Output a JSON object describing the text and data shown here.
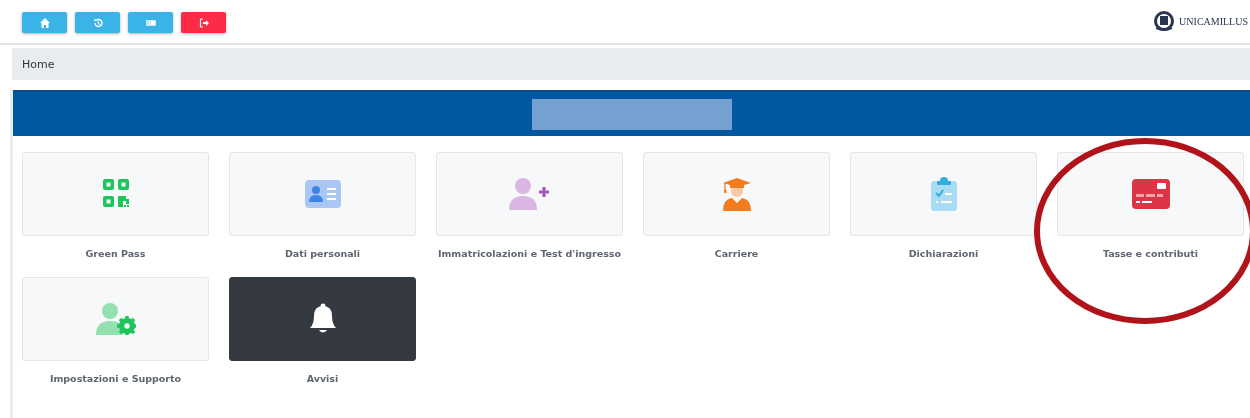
{
  "toolbar": {
    "buttons": [
      {
        "kind": "home",
        "color": "#3ab4e6"
      },
      {
        "kind": "history",
        "color": "#3ab4e6"
      },
      {
        "kind": "id-card",
        "color": "#3ab4e6"
      },
      {
        "kind": "logout",
        "color": "#fd2b46"
      }
    ]
  },
  "logo": {
    "text": "UNICAMILLUS"
  },
  "breadcrumb": {
    "text": "Home"
  },
  "banner": {
    "redacted": true
  },
  "tiles": [
    {
      "label": "Green Pass",
      "kind": "qr",
      "dark": false
    },
    {
      "label": "Dati personali",
      "kind": "id-card",
      "dark": false
    },
    {
      "label": "Immatricolazioni e Test d'ingresso",
      "kind": "user-plus",
      "dark": false
    },
    {
      "label": "Carriere",
      "kind": "graduate",
      "dark": false
    },
    {
      "label": "Dichiarazioni",
      "kind": "clipboard",
      "dark": false
    },
    {
      "label": "Tasse e contributi",
      "kind": "credit-card",
      "dark": false
    },
    {
      "label": "Impostazioni e Supporto",
      "kind": "user-gear",
      "dark": false
    },
    {
      "label": "Avvisi",
      "kind": "bell",
      "dark": true
    }
  ],
  "annotation": {
    "kind": "circle",
    "color": "#b0141a"
  }
}
